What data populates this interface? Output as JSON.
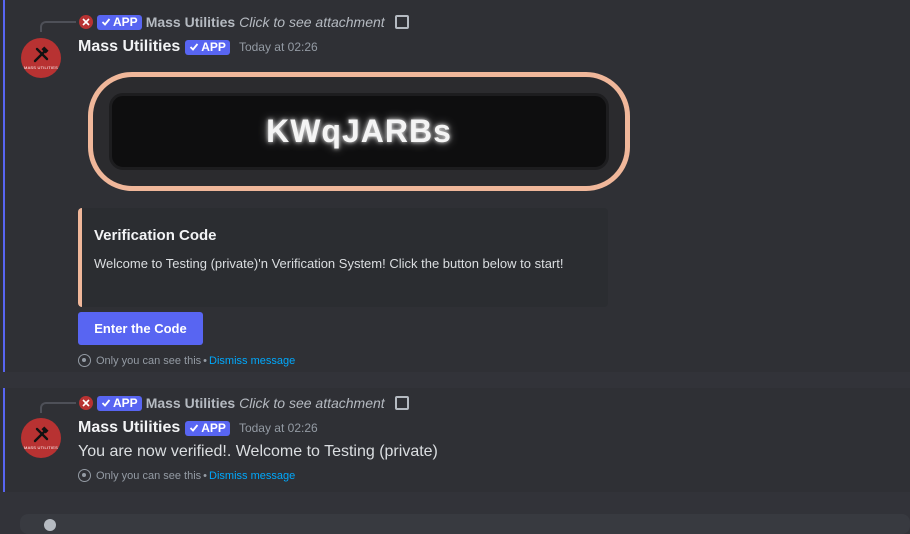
{
  "messages": [
    {
      "reply": {
        "author": "Mass Utilities",
        "badge": "APP",
        "text": "Click to see attachment"
      },
      "author": "Mass Utilities",
      "badge": "APP",
      "timestamp": "Today at 02:26",
      "attachment_code": "KWqJARBs",
      "embed": {
        "title": "Verification Code",
        "description": "Welcome to Testing (private)'n Verification System! Click the button below to start!"
      },
      "button_label": "Enter the Code",
      "ephemeral": {
        "note": "Only you can see this",
        "separator": "•",
        "dismiss": "Dismiss message"
      }
    },
    {
      "reply": {
        "author": "Mass Utilities",
        "badge": "APP",
        "text": "Click to see attachment"
      },
      "author": "Mass Utilities",
      "badge": "APP",
      "timestamp": "Today at 02:26",
      "content": "You are now verified!. Welcome to Testing (private)",
      "ephemeral": {
        "note": "Only you can see this",
        "separator": "•",
        "dismiss": "Dismiss message"
      }
    }
  ],
  "colors": {
    "accent": "#5865f2",
    "embed_border": "#f0b79a",
    "link": "#00a8fc",
    "avatar": "#b83232"
  },
  "icons": [
    "hammer-wrench-icon",
    "checkmark-icon",
    "image-icon",
    "eye-icon"
  ]
}
